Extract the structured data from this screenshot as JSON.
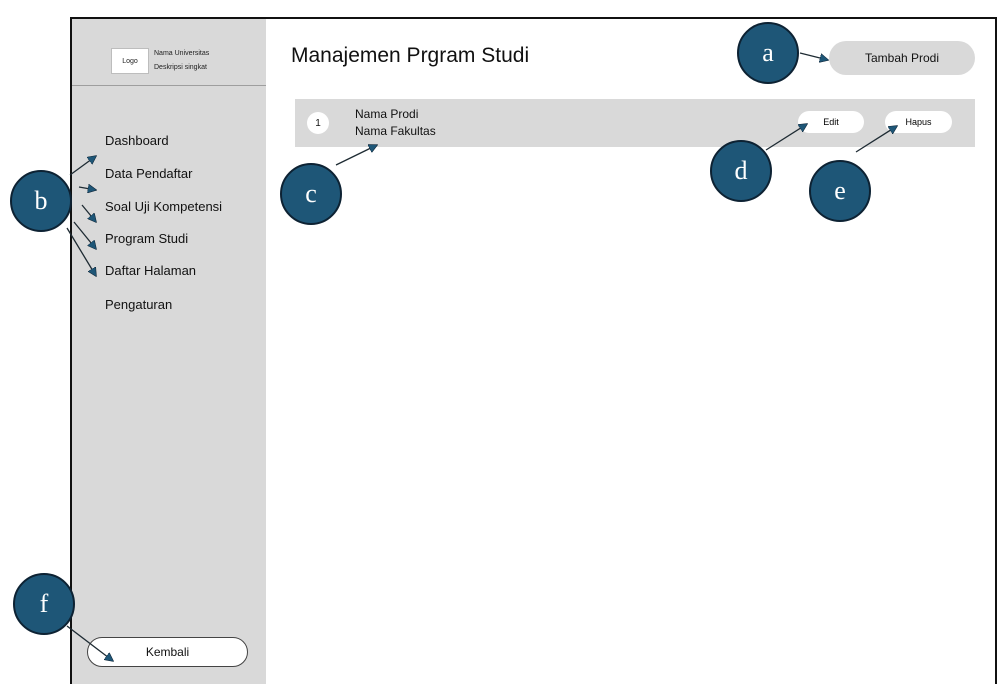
{
  "sidebar": {
    "logo": "Logo",
    "university_name": "Nama Universitas",
    "university_description": "Deskripsi singkat",
    "items": [
      {
        "label": "Dashboard"
      },
      {
        "label": "Data Pendaftar"
      },
      {
        "label": "Soal Uji Kompetensi"
      },
      {
        "label": "Program Studi"
      },
      {
        "label": "Daftar Halaman"
      },
      {
        "label": "Pengaturan"
      }
    ],
    "back_label": "Kembali"
  },
  "main": {
    "title": "Manajemen Prgram Studi",
    "add_label": "Tambah Prodi",
    "rows": [
      {
        "number": "1",
        "name": "Nama Prodi",
        "faculty": "Nama Fakultas",
        "edit_label": "Edit",
        "delete_label": "Hapus"
      }
    ]
  },
  "annotations": {
    "a": "a",
    "b": "b",
    "c": "c",
    "d": "d",
    "e": "e",
    "f": "f",
    "marker_color": "#1e5677",
    "arrow_color": "#1e5677"
  }
}
